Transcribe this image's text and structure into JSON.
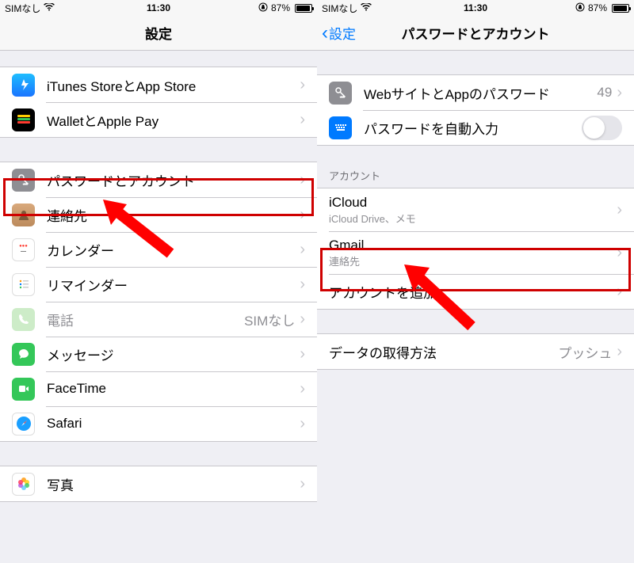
{
  "statusbar": {
    "carrier": "SIMなし",
    "time": "11:30",
    "battery_pct": "87%"
  },
  "left": {
    "title": "設定",
    "groups": [
      [
        {
          "icon": "appstore-icon",
          "label": "iTunes StoreとApp Store"
        },
        {
          "icon": "wallet-icon",
          "label": "WalletとApple Pay"
        }
      ],
      [
        {
          "icon": "key-icon",
          "label": "パスワードとアカウント",
          "highlight": true
        },
        {
          "icon": "contacts-icon",
          "label": "連絡先"
        },
        {
          "icon": "calendar-icon",
          "label": "カレンダー"
        },
        {
          "icon": "reminders-icon",
          "label": "リマインダー"
        },
        {
          "icon": "phone-icon",
          "label": "電話",
          "detail": "SIMなし",
          "dim": true
        },
        {
          "icon": "messages-icon",
          "label": "メッセージ"
        },
        {
          "icon": "facetime-icon",
          "label": "FaceTime"
        },
        {
          "icon": "safari-icon",
          "label": "Safari"
        }
      ],
      [
        {
          "icon": "photos-icon",
          "label": "写真"
        }
      ]
    ]
  },
  "right": {
    "back": "設定",
    "title": "パスワードとアカウント",
    "password_row": {
      "label": "WebサイトとAppのパスワード",
      "count": "49"
    },
    "autofill_row": {
      "label": "パスワードを自動入力"
    },
    "accounts_header": "アカウント",
    "accounts": [
      {
        "title": "iCloud",
        "subtitle": "iCloud Drive、メモ"
      },
      {
        "title": "Gmail",
        "subtitle": "連絡先",
        "highlight": true
      },
      {
        "title": "アカウントを追加"
      }
    ],
    "fetch_row": {
      "label": "データの取得方法",
      "detail": "プッシュ"
    }
  }
}
